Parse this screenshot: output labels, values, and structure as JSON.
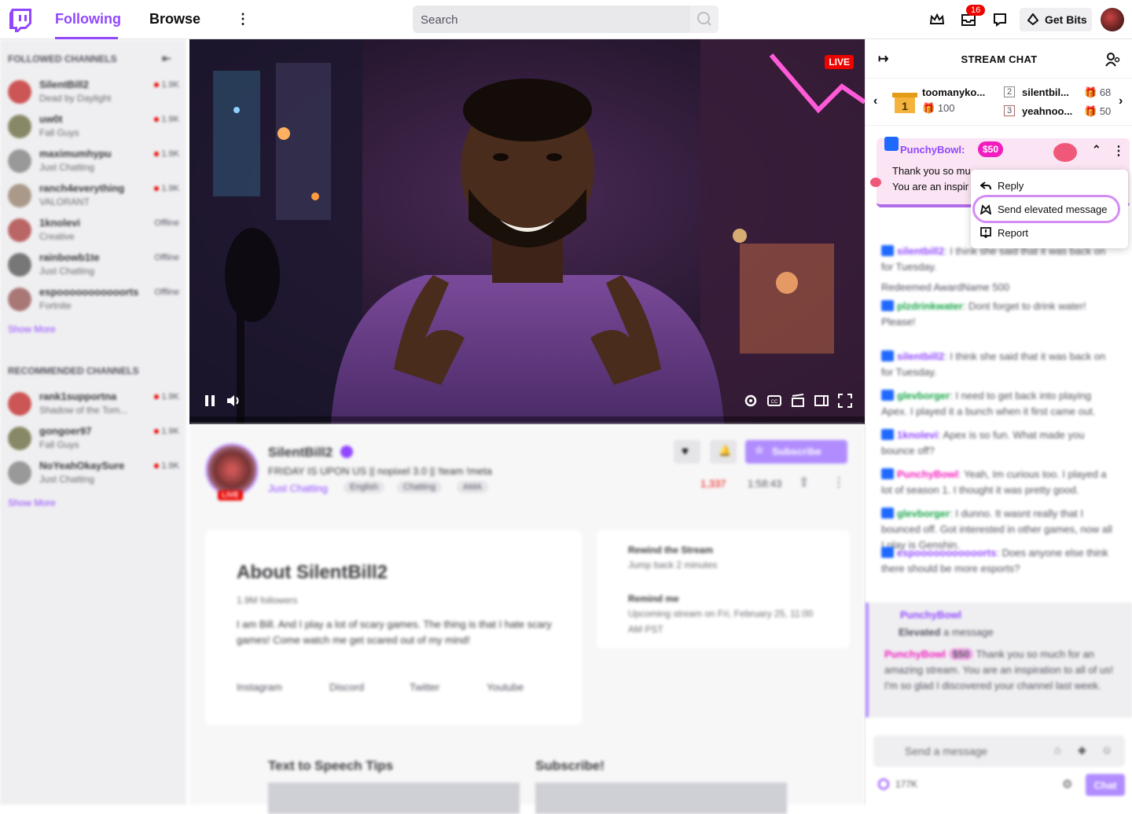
{
  "nav": {
    "following": "Following",
    "browse": "Browse",
    "search_placeholder": "Search",
    "notification_count": "16",
    "get_bits": "Get Bits"
  },
  "sidebar": {
    "followed_header": "FOLLOWED CHANNELS",
    "followed": [
      {
        "name": "SilentBill2",
        "game": "Dead by Daylight",
        "viewers": "1.9K",
        "live": true
      },
      {
        "name": "uw0t",
        "game": "Fall Guys",
        "viewers": "1.9K",
        "live": true
      },
      {
        "name": "maximumhypu",
        "game": "Just Chatting",
        "viewers": "1.9K",
        "live": true
      },
      {
        "name": "ranch4everything",
        "game": "VALORANT",
        "viewers": "1.9K",
        "live": true
      },
      {
        "name": "1knolevi",
        "game": "Creative",
        "viewers": "Offline",
        "live": false
      },
      {
        "name": "rainbowb1te",
        "game": "Just Chatting",
        "viewers": "Offline",
        "live": false
      },
      {
        "name": "espooooooooooorts",
        "game": "Fortnite",
        "viewers": "Offline",
        "live": false
      }
    ],
    "show_more": "Show More",
    "recommended_header": "RECOMMENDED CHANNELS",
    "recommended": [
      {
        "name": "rank1supportna",
        "game": "Shadow of the Tom...",
        "viewers": "1.9K",
        "live": true
      },
      {
        "name": "gongoer97",
        "game": "Fall Guys",
        "viewers": "1.9K",
        "live": true
      },
      {
        "name": "NoYeahOkaySure",
        "game": "Just Chatting",
        "viewers": "1.9K",
        "live": true
      }
    ]
  },
  "video": {
    "live_label": "LIVE"
  },
  "channel": {
    "name": "SilentBill2",
    "title": "FRIDAY IS UPON US || nopixel 3.0 || !team !meta",
    "category": "Just Chatting",
    "tags": [
      "English",
      "Chatting",
      "AMA"
    ],
    "live_label": "LIVE",
    "subscribe": "Subscribe",
    "viewers": "1,337",
    "uptime": "1:58:43"
  },
  "about": {
    "title": "About SilentBill2",
    "followers_count": "1.9M",
    "followers_label": "followers",
    "description": "I am Bill. And I play a lot of scary games. The thing is that I hate scary games! Come watch me get scared out of my mind!",
    "socials": [
      "Instagram",
      "Discord",
      "Twitter",
      "Youtube"
    ]
  },
  "side_card": {
    "rewind_title": "Rewind the Stream",
    "rewind_sub": "Jump back 2 minutes",
    "remind_title": "Remind me",
    "remind_sub": "Upcoming stream on Fri, February 25, 11:00 AM PST"
  },
  "panels": [
    "Text to Speech Tips",
    "Subscribe!"
  ],
  "chat": {
    "title": "STREAM CHAT",
    "gifters": [
      {
        "name": "toomanyko...",
        "amount": "100",
        "rank": "1"
      },
      {
        "name": "silentbil...",
        "amount": "68",
        "rank": "2"
      },
      {
        "name": "yeahnoo...",
        "amount": "50",
        "rank": "3"
      }
    ],
    "pinned": {
      "user": "PunchyBowl:",
      "amount": "$50",
      "line1": "Thank you so mu",
      "line2": "You are an inspir"
    },
    "menu": {
      "reply": "Reply",
      "elevated": "Send elevated message",
      "report": "Report"
    },
    "messages": [
      {
        "user": "silentbill2",
        "text": "I think she said that it was back on for Tuesday."
      },
      {
        "user": "",
        "text": "Redeemed AwardName 500"
      },
      {
        "user": "plzdrinkwater",
        "text": "Dont forget to drink water! Please!"
      },
      {
        "user": "silentbill2",
        "text": "I think she said that it was back on for Tuesday."
      },
      {
        "user": "glevborger",
        "text": "I need to get back into playing Apex. I played it a bunch when it first came out."
      },
      {
        "user": "1knolevi",
        "text": "Apex is so fun. What made you bounce off?"
      },
      {
        "user": "PunchyBowl",
        "text": "Yeah, Im curious too. I played a lot of season 1. I thought it was pretty good."
      },
      {
        "user": "glevborger",
        "text": "I dunno. It wasnt really that I bounced off. Got interested in other games, now all I play is Genshin."
      },
      {
        "user": "espooooooooooorts",
        "text": "Does anyone else think there should be more esports?"
      }
    ],
    "elevated": {
      "user": "PunchyBowl",
      "action": "Elevated",
      "action_rest": "a message",
      "amount": "$50",
      "text": "Thank you so much for an amazing stream. You are an inspiration to all of us! I'm so glad I discovered your channel last week."
    },
    "input_placeholder": "Send a message",
    "points": "177K",
    "chat_button": "Chat"
  },
  "colors": {
    "brand": "#9147ff",
    "live": "#eb0400",
    "elevated": "#f21dbf"
  }
}
